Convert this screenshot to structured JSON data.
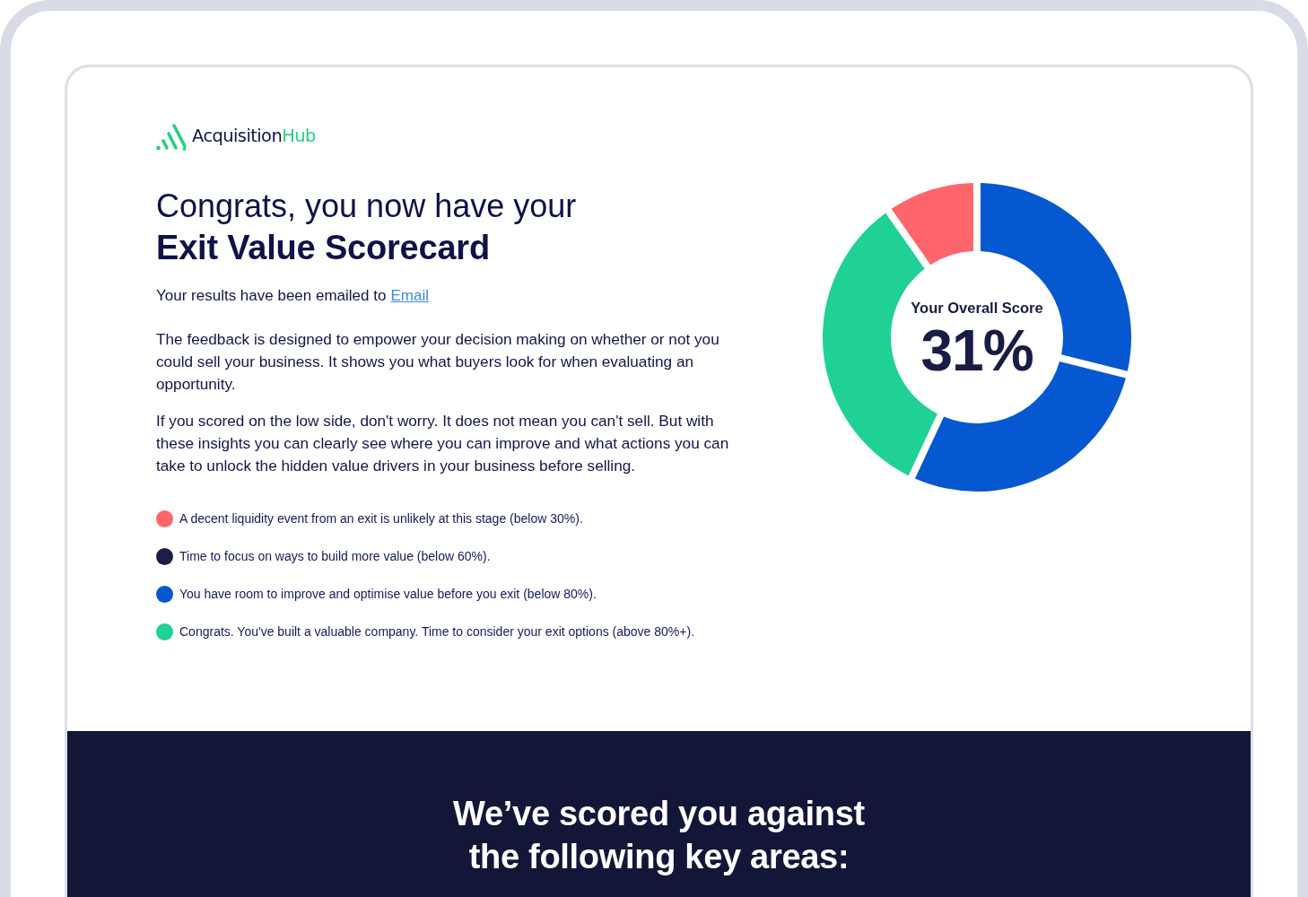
{
  "logo": {
    "name": "Acquisition",
    "accent": "Hub"
  },
  "heading": {
    "line_1": "Congrats, you now have your",
    "line_2": "Exit Value Scorecard"
  },
  "email_notice": {
    "text": "Your results have been emailed to",
    "link": "Email"
  },
  "paragraphs": [
    "The feedback is designed to empower your decision making on whether or not you could sell your business. It shows you what buyers look for when evaluating an opportunity.",
    "If you scored on the low side, don't worry. It does not mean you can't sell. But with these insights you can clearly see where you can improve and what actions you can take to unlock the hidden value drivers in your business before selling."
  ],
  "legend": [
    {
      "text": "A decent liquidity event from an exit is unlikely at this stage (below 30%).",
      "color": "#fe666c"
    },
    {
      "text": "Time to focus on ways to build more value (below 60%).",
      "color": "#1b1f45"
    },
    {
      "text": "You have room to improve and optimise value before you exit (below 80%).",
      "color": "#0658d0"
    },
    {
      "text": "Congrats. You've built a valuable company. Time to consider your exit options (above 80%+).",
      "color": "#1fd196"
    }
  ],
  "score": {
    "label": "Your Overall Score",
    "value": "31%"
  },
  "key_areas": {
    "heading": "We’ve scored you against the following key areas:"
  }
}
